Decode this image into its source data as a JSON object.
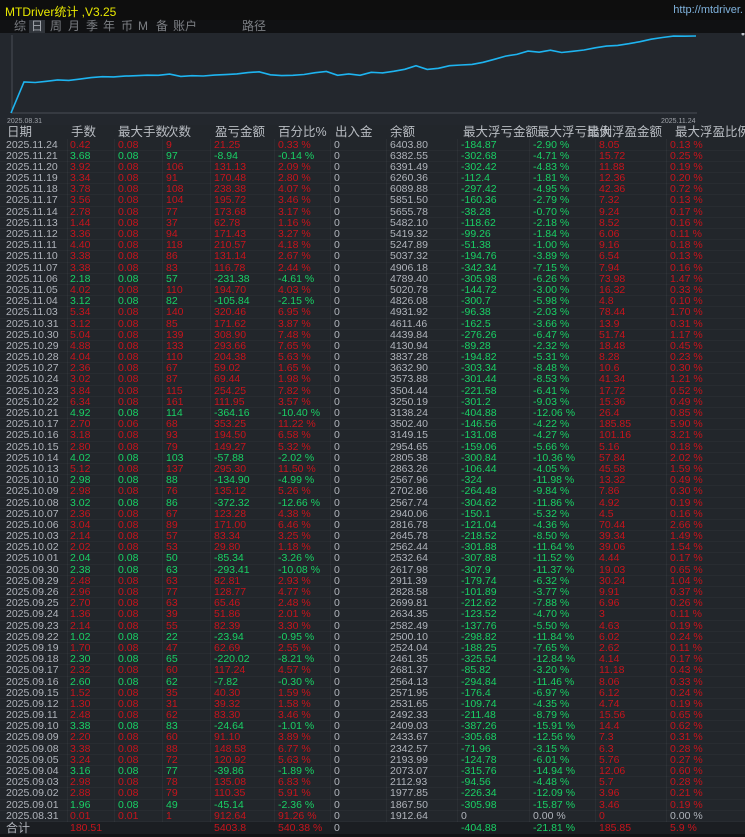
{
  "window": {
    "title": "MTDriver统计 ,V3.25",
    "url": "http://mtdriver."
  },
  "tabs": [
    {
      "label": "综",
      "active": false
    },
    {
      "label": "日",
      "active": true
    },
    {
      "label": "周",
      "active": false
    },
    {
      "label": "月",
      "active": false
    },
    {
      "label": "季",
      "active": false
    },
    {
      "label": "年",
      "active": false
    },
    {
      "label": "币",
      "active": false
    },
    {
      "label": "M",
      "active": false
    },
    {
      "label": "备",
      "active": false
    },
    {
      "label": "账户",
      "active": false
    },
    {
      "label": "路径",
      "active": false
    }
  ],
  "chart_data": {
    "type": "line",
    "x_tick_labels": [
      "2025.08.31",
      "2025.11.24"
    ],
    "series_source": "table balance column (chronological)",
    "line_color": "#1eb4f0"
  },
  "colors": {
    "profit": "#c8141c",
    "loss": "#19d165",
    "neutral": "#b0b4bb",
    "title": "#e8e800"
  },
  "table": {
    "headers": [
      "日期",
      "手数",
      "最大手数",
      "次数",
      "盈亏金额",
      "百分比%",
      "出入金",
      "余额",
      "最大浮亏金额",
      "最大浮亏比例",
      "最大浮盈金额",
      "最大浮盈比例"
    ],
    "rows": [
      [
        "2025.11.24",
        "0.42",
        "0.08",
        "9",
        "21.25",
        "0.33 %",
        "0",
        "6403.80",
        "-184.87",
        "-2.90 %",
        "8.05",
        "0.13 %"
      ],
      [
        "2025.11.21",
        "3.68",
        "0.08",
        "97",
        "-8.94",
        "-0.14 %",
        "0",
        "6382.55",
        "-302.68",
        "-4.71 %",
        "15.72",
        "0.25 %"
      ],
      [
        "2025.11.20",
        "3.92",
        "0.08",
        "106",
        "131.13",
        "2.09 %",
        "0",
        "6391.49",
        "-302.42",
        "-4.83 %",
        "11.88",
        "0.19 %"
      ],
      [
        "2025.11.19",
        "3.34",
        "0.08",
        "91",
        "170.48",
        "2.80 %",
        "0",
        "6260.36",
        "-112.4",
        "-1.81 %",
        "12.36",
        "0.20 %"
      ],
      [
        "2025.11.18",
        "3.78",
        "0.08",
        "108",
        "238.38",
        "4.07 %",
        "0",
        "6089.88",
        "-297.42",
        "-4.95 %",
        "42.36",
        "0.72 %"
      ],
      [
        "2025.11.17",
        "3.56",
        "0.08",
        "104",
        "195.72",
        "3.46 %",
        "0",
        "5851.50",
        "-160.36",
        "-2.79 %",
        "7.32",
        "0.13 %"
      ],
      [
        "2025.11.14",
        "2.78",
        "0.08",
        "77",
        "173.68",
        "3.17 %",
        "0",
        "5655.78",
        "-38.28",
        "-0.70 %",
        "9.24",
        "0.17 %"
      ],
      [
        "2025.11.13",
        "1.44",
        "0.08",
        "37",
        "62.78",
        "1.16 %",
        "0",
        "5482.10",
        "-118.62",
        "-2.18 %",
        "8.52",
        "0.16 %"
      ],
      [
        "2025.11.12",
        "3.36",
        "0.08",
        "94",
        "171.43",
        "3.27 %",
        "0",
        "5419.32",
        "-99.26",
        "-1.84 %",
        "6.06",
        "0.11 %"
      ],
      [
        "2025.11.11",
        "4.40",
        "0.08",
        "118",
        "210.57",
        "4.18 %",
        "0",
        "5247.89",
        "-51.38",
        "-1.00 %",
        "9.16",
        "0.18 %"
      ],
      [
        "2025.11.10",
        "3.38",
        "0.08",
        "86",
        "131.14",
        "2.67 %",
        "0",
        "5037.32",
        "-194.76",
        "-3.89 %",
        "6.54",
        "0.13 %"
      ],
      [
        "2025.11.07",
        "3.38",
        "0.08",
        "83",
        "116.78",
        "2.44 %",
        "0",
        "4906.18",
        "-342.34",
        "-7.15 %",
        "7.94",
        "0.16 %"
      ],
      [
        "2025.11.06",
        "2.18",
        "0.08",
        "57",
        "-231.38",
        "-4.61 %",
        "0",
        "4789.40",
        "-305.98",
        "-6.26 %",
        "73.98",
        "1.47 %"
      ],
      [
        "2025.11.05",
        "4.02",
        "0.08",
        "110",
        "194.70",
        "4.03 %",
        "0",
        "5020.78",
        "-144.72",
        "-3.00 %",
        "16.32",
        "0.33 %"
      ],
      [
        "2025.11.04",
        "3.12",
        "0.08",
        "82",
        "-105.84",
        "-2.15 %",
        "0",
        "4826.08",
        "-300.7",
        "-5.98 %",
        "4.8",
        "0.10 %"
      ],
      [
        "2025.11.03",
        "5.34",
        "0.08",
        "140",
        "320.46",
        "6.95 %",
        "0",
        "4931.92",
        "-96.38",
        "-2.03 %",
        "78.44",
        "1.70 %"
      ],
      [
        "2025.10.31",
        "3.12",
        "0.08",
        "85",
        "171.62",
        "3.87 %",
        "0",
        "4611.46",
        "-162.5",
        "-3.66 %",
        "13.9",
        "0.31 %"
      ],
      [
        "2025.10.30",
        "5.04",
        "0.08",
        "139",
        "308.90",
        "7.48 %",
        "0",
        "4439.84",
        "-276.26",
        "-6.47 %",
        "51.74",
        "1.17 %"
      ],
      [
        "2025.10.29",
        "4.88",
        "0.08",
        "133",
        "293.66",
        "7.65 %",
        "0",
        "4130.94",
        "-89.28",
        "-2.32 %",
        "18.48",
        "0.45 %"
      ],
      [
        "2025.10.28",
        "4.04",
        "0.08",
        "110",
        "204.38",
        "5.63 %",
        "0",
        "3837.28",
        "-194.82",
        "-5.31 %",
        "8.28",
        "0.23 %"
      ],
      [
        "2025.10.27",
        "2.36",
        "0.08",
        "67",
        "59.02",
        "1.65 %",
        "0",
        "3632.90",
        "-303.34",
        "-8.48 %",
        "10.6",
        "0.30 %"
      ],
      [
        "2025.10.24",
        "3.02",
        "0.08",
        "87",
        "69.44",
        "1.98 %",
        "0",
        "3573.88",
        "-301.44",
        "-8.53 %",
        "41.34",
        "1.21 %"
      ],
      [
        "2025.10.23",
        "3.84",
        "0.08",
        "115",
        "254.25",
        "7.82 %",
        "0",
        "3504.44",
        "-221.58",
        "-6.41 %",
        "17.72",
        "0.52 %"
      ],
      [
        "2025.10.22",
        "6.34",
        "0.08",
        "161",
        "111.95",
        "3.57 %",
        "0",
        "3250.19",
        "-301.2",
        "-9.03 %",
        "15.36",
        "0.49 %"
      ],
      [
        "2025.10.21",
        "4.92",
        "0.08",
        "114",
        "-364.16",
        "-10.40 %",
        "0",
        "3138.24",
        "-404.88",
        "-12.06 %",
        "26.4",
        "0.85 %"
      ],
      [
        "2025.10.17",
        "2.70",
        "0.06",
        "68",
        "353.25",
        "11.22 %",
        "0",
        "3502.40",
        "-146.56",
        "-4.22 %",
        "185.85",
        "5.90 %"
      ],
      [
        "2025.10.16",
        "3.18",
        "0.08",
        "93",
        "194.50",
        "6.58 %",
        "0",
        "3149.15",
        "-131.08",
        "-4.27 %",
        "101.16",
        "3.21 %"
      ],
      [
        "2025.10.15",
        "2.80",
        "0.08",
        "79",
        "149.27",
        "5.32 %",
        "0",
        "2954.65",
        "-159.06",
        "-5.66 %",
        "5.16",
        "0.18 %"
      ],
      [
        "2025.10.14",
        "4.02",
        "0.08",
        "103",
        "-57.88",
        "-2.02 %",
        "0",
        "2805.38",
        "-300.84",
        "-10.36 %",
        "57.84",
        "2.02 %"
      ],
      [
        "2025.10.13",
        "5.12",
        "0.08",
        "137",
        "295.30",
        "11.50 %",
        "0",
        "2863.26",
        "-106.44",
        "-4.05 %",
        "45.58",
        "1.59 %"
      ],
      [
        "2025.10.10",
        "2.98",
        "0.08",
        "88",
        "-134.90",
        "-4.99 %",
        "0",
        "2567.96",
        "-324",
        "-11.98 %",
        "13.32",
        "0.49 %"
      ],
      [
        "2025.10.09",
        "2.98",
        "0.08",
        "76",
        "135.12",
        "5.26 %",
        "0",
        "2702.86",
        "-264.48",
        "-9.84 %",
        "7.86",
        "0.30 %"
      ],
      [
        "2025.10.08",
        "3.02",
        "0.08",
        "86",
        "-372.32",
        "-12.66 %",
        "0",
        "2567.74",
        "-304.62",
        "-11.86 %",
        "4.92",
        "0.19 %"
      ],
      [
        "2025.10.07",
        "2.36",
        "0.08",
        "67",
        "123.28",
        "4.38 %",
        "0",
        "2940.06",
        "-150.1",
        "-5.32 %",
        "4.5",
        "0.16 %"
      ],
      [
        "2025.10.06",
        "3.04",
        "0.08",
        "89",
        "171.00",
        "6.46 %",
        "0",
        "2816.78",
        "-121.04",
        "-4.36 %",
        "70.44",
        "2.66 %"
      ],
      [
        "2025.10.03",
        "2.14",
        "0.08",
        "57",
        "83.34",
        "3.25 %",
        "0",
        "2645.78",
        "-218.52",
        "-8.50 %",
        "39.34",
        "1.49 %"
      ],
      [
        "2025.10.02",
        "2.02",
        "0.08",
        "53",
        "29.80",
        "1.18 %",
        "0",
        "2562.44",
        "-301.88",
        "-11.64 %",
        "39.06",
        "1.54 %"
      ],
      [
        "2025.10.01",
        "2.04",
        "0.08",
        "50",
        "-85.34",
        "-3.26 %",
        "0",
        "2532.64",
        "-307.88",
        "-11.52 %",
        "4.44",
        "0.17 %"
      ],
      [
        "2025.09.30",
        "2.38",
        "0.08",
        "63",
        "-293.41",
        "-10.08 %",
        "0",
        "2617.98",
        "-307.9",
        "-11.37 %",
        "19.03",
        "0.65 %"
      ],
      [
        "2025.09.29",
        "2.48",
        "0.08",
        "63",
        "82.81",
        "2.93 %",
        "0",
        "2911.39",
        "-179.74",
        "-6.32 %",
        "30.24",
        "1.04 %"
      ],
      [
        "2025.09.26",
        "2.96",
        "0.08",
        "77",
        "128.77",
        "4.77 %",
        "0",
        "2828.58",
        "-101.89",
        "-3.77 %",
        "9.91",
        "0.37 %"
      ],
      [
        "2025.09.25",
        "2.70",
        "0.08",
        "63",
        "65.46",
        "2.48 %",
        "0",
        "2699.81",
        "-212.62",
        "-7.88 %",
        "6.96",
        "0.26 %"
      ],
      [
        "2025.09.24",
        "1.36",
        "0.08",
        "39",
        "51.86",
        "2.01 %",
        "0",
        "2634.35",
        "-123.52",
        "-4.70 %",
        "3",
        "0.11 %"
      ],
      [
        "2025.09.23",
        "2.14",
        "0.08",
        "55",
        "82.39",
        "3.30 %",
        "0",
        "2582.49",
        "-137.76",
        "-5.50 %",
        "4.63",
        "0.19 %"
      ],
      [
        "2025.09.22",
        "1.02",
        "0.08",
        "22",
        "-23.94",
        "-0.95 %",
        "0",
        "2500.10",
        "-298.82",
        "-11.84 %",
        "6.02",
        "0.24 %"
      ],
      [
        "2025.09.19",
        "1.70",
        "0.08",
        "47",
        "62.69",
        "2.55 %",
        "0",
        "2524.04",
        "-188.25",
        "-7.65 %",
        "2.62",
        "0.11 %"
      ],
      [
        "2025.09.18",
        "2.30",
        "0.08",
        "65",
        "-220.02",
        "-8.21 %",
        "0",
        "2461.35",
        "-325.54",
        "-12.84 %",
        "4.14",
        "0.17 %"
      ],
      [
        "2025.09.17",
        "2.32",
        "0.08",
        "60",
        "117.24",
        "4.57 %",
        "0",
        "2681.37",
        "-85.82",
        "-3.20 %",
        "11.18",
        "0.43 %"
      ],
      [
        "2025.09.16",
        "2.60",
        "0.08",
        "62",
        "-7.82",
        "-0.30 %",
        "0",
        "2564.13",
        "-294.84",
        "-11.46 %",
        "8.06",
        "0.33 %"
      ],
      [
        "2025.09.15",
        "1.52",
        "0.08",
        "35",
        "40.30",
        "1.59 %",
        "0",
        "2571.95",
        "-176.4",
        "-6.97 %",
        "6.12",
        "0.24 %"
      ],
      [
        "2025.09.12",
        "1.30",
        "0.08",
        "31",
        "39.32",
        "1.58 %",
        "0",
        "2531.65",
        "-109.74",
        "-4.35 %",
        "4.74",
        "0.19 %"
      ],
      [
        "2025.09.11",
        "2.48",
        "0.08",
        "62",
        "83.30",
        "3.46 %",
        "0",
        "2492.33",
        "-211.48",
        "-8.79 %",
        "15.56",
        "0.65 %"
      ],
      [
        "2025.09.10",
        "3.38",
        "0.08",
        "83",
        "-24.64",
        "-1.01 %",
        "0",
        "2409.03",
        "-387.26",
        "-15.91 %",
        "14.4",
        "0.62 %"
      ],
      [
        "2025.09.09",
        "2.20",
        "0.08",
        "60",
        "91.10",
        "3.89 %",
        "0",
        "2433.67",
        "-305.68",
        "-12.56 %",
        "7.3",
        "0.31 %"
      ],
      [
        "2025.09.08",
        "3.38",
        "0.08",
        "88",
        "148.58",
        "6.77 %",
        "0",
        "2342.57",
        "-71.96",
        "-3.15 %",
        "6.3",
        "0.28 %"
      ],
      [
        "2025.09.05",
        "3.24",
        "0.08",
        "72",
        "120.92",
        "5.63 %",
        "0",
        "2193.99",
        "-124.78",
        "-6.01 %",
        "5.76",
        "0.27 %"
      ],
      [
        "2025.09.04",
        "3.16",
        "0.08",
        "77",
        "-39.86",
        "-1.89 %",
        "0",
        "2073.07",
        "-315.76",
        "-14.94 %",
        "12.06",
        "0.60 %"
      ],
      [
        "2025.09.03",
        "2.98",
        "0.08",
        "78",
        "135.08",
        "6.83 %",
        "0",
        "2112.93",
        "-94.56",
        "-4.48 %",
        "5.7",
        "0.28 %"
      ],
      [
        "2025.09.02",
        "2.88",
        "0.08",
        "79",
        "110.35",
        "5.91 %",
        "0",
        "1977.85",
        "-226.34",
        "-12.09 %",
        "3.96",
        "0.21 %"
      ],
      [
        "2025.09.01",
        "1.96",
        "0.08",
        "49",
        "-45.14",
        "-2.36 %",
        "0",
        "1867.50",
        "-305.98",
        "-15.87 %",
        "3.46",
        "0.19 %"
      ],
      [
        "2025.08.31",
        "0.01",
        "0.01",
        "1",
        "912.64",
        "91.26 %",
        "0",
        "1912.64",
        "0",
        "0.00 %",
        "0",
        "0.00 %"
      ]
    ],
    "total": [
      "合计",
      "180.51",
      "",
      "",
      "5403.8",
      "540.38 %",
      "0",
      "",
      "-404.88",
      "-21.81 %",
      "185.85",
      "5.9 %"
    ]
  }
}
